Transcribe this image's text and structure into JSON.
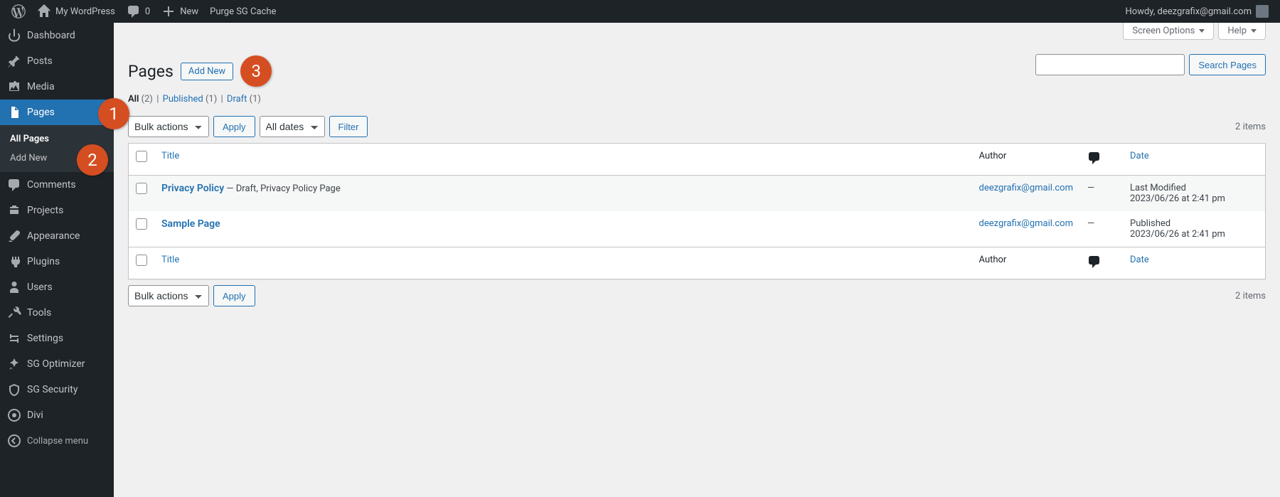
{
  "adminbar": {
    "site_name": "My WordPress",
    "comment_count": "0",
    "new_label": "New",
    "purge_label": "Purge SG Cache",
    "howdy": "Howdy, deezgrafix@gmail.com"
  },
  "sidebar": {
    "items": [
      {
        "label": "Dashboard"
      },
      {
        "label": "Posts"
      },
      {
        "label": "Media"
      },
      {
        "label": "Pages"
      },
      {
        "label": "Comments"
      },
      {
        "label": "Projects"
      },
      {
        "label": "Appearance"
      },
      {
        "label": "Plugins"
      },
      {
        "label": "Users"
      },
      {
        "label": "Tools"
      },
      {
        "label": "Settings"
      },
      {
        "label": "SG Optimizer"
      },
      {
        "label": "SG Security"
      },
      {
        "label": "Divi"
      }
    ],
    "submenu": {
      "all_pages": "All Pages",
      "add_new": "Add New"
    },
    "collapse": "Collapse menu"
  },
  "header": {
    "title": "Pages",
    "add_new": "Add New",
    "screen_options": "Screen Options",
    "help": "Help"
  },
  "filters": {
    "all_label": "All",
    "all_count": "(2)",
    "published_label": "Published",
    "published_count": "(1)",
    "draft_label": "Draft",
    "draft_count": "(1)"
  },
  "search": {
    "button": "Search Pages"
  },
  "tablenav": {
    "bulk": "Bulk actions",
    "apply": "Apply",
    "dates": "All dates",
    "filter": "Filter",
    "items": "2 items"
  },
  "table": {
    "cols": {
      "title": "Title",
      "author": "Author",
      "date": "Date"
    },
    "rows": [
      {
        "title": "Privacy Policy",
        "state": "— Draft, Privacy Policy Page",
        "author": "deezgrafix@gmail.com",
        "comments": "—",
        "date_status": "Last Modified",
        "date_value": "2023/06/26 at 2:41 pm"
      },
      {
        "title": "Sample Page",
        "state": "",
        "author": "deezgrafix@gmail.com",
        "comments": "—",
        "date_status": "Published",
        "date_value": "2023/06/26 at 2:41 pm"
      }
    ]
  },
  "annotations": {
    "b1": "1",
    "b2": "2",
    "b3": "3"
  }
}
